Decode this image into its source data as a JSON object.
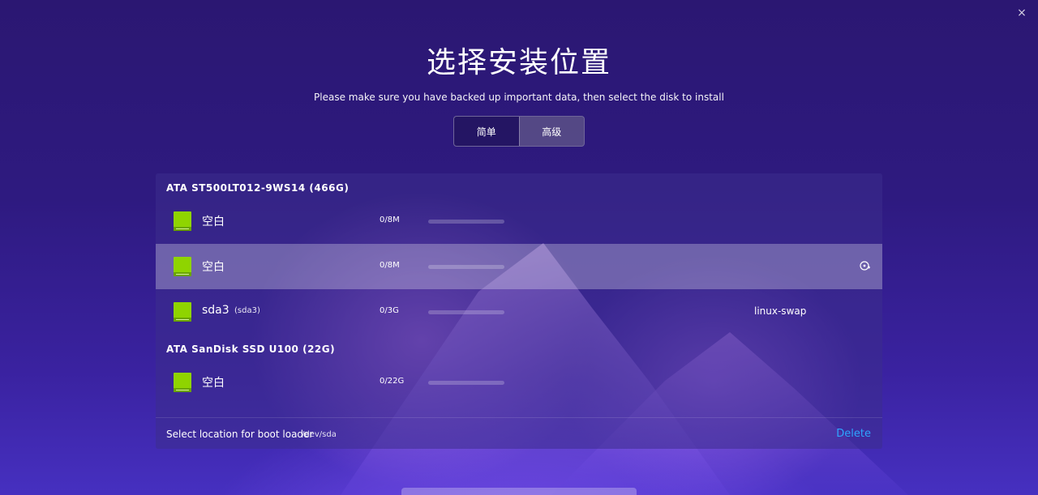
{
  "window": {
    "close_glyph": "×"
  },
  "page": {
    "title": "选择安装位置",
    "subtitle": "Please make sure you have backed up important data, then select the disk to install"
  },
  "mode_tabs": [
    {
      "label": "简单",
      "active": false
    },
    {
      "label": "高级",
      "active": true
    }
  ],
  "disks": [
    {
      "header": "ATA ST500LT012-9WS14 (466G)",
      "partitions": [
        {
          "name": "空白",
          "label": "",
          "usage": "0/8M",
          "used_fraction": 0,
          "filesystem": "",
          "selected": false
        },
        {
          "name": "空白",
          "label": "",
          "usage": "0/8M",
          "used_fraction": 0,
          "filesystem": "",
          "selected": true
        },
        {
          "name": "sda3",
          "label": "(sda3)",
          "usage": "0/3G",
          "used_fraction": 0,
          "filesystem": "linux-swap",
          "selected": false
        }
      ]
    },
    {
      "header": "ATA SanDisk SSD U100 (22G)",
      "partitions": [
        {
          "name": "空白",
          "label": "",
          "usage": "0/22G",
          "used_fraction": 0,
          "filesystem": "",
          "selected": false
        }
      ]
    }
  ],
  "footer": {
    "bootloader_label": "Select location for boot loader",
    "bootloader_device": "/dev/sda",
    "delete_label": "Delete"
  },
  "colors": {
    "accent": "#2ea6ff",
    "partition_icon": "#8fd400",
    "background": "#2e1a80"
  },
  "icons": {
    "partition": "drive-partition-icon",
    "format": "format-partition-icon",
    "close": "close-icon"
  }
}
